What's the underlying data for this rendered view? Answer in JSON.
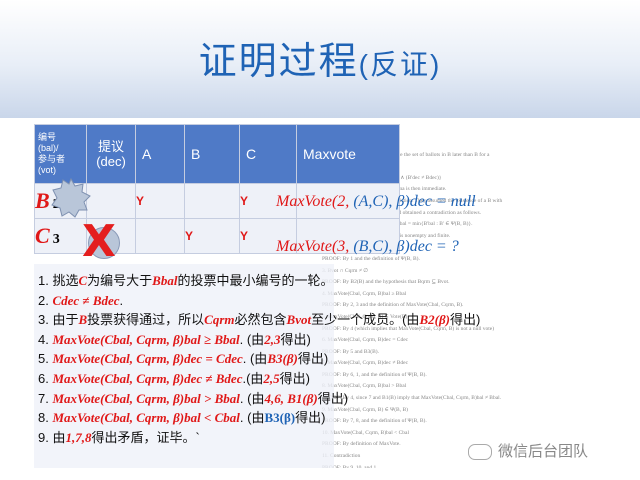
{
  "slide": {
    "title_main": "证明过程",
    "title_paren": "(反证)"
  },
  "table": {
    "headers": [
      "编号\n(bal)/\n参与者\n(vot)",
      "提议\n(dec)",
      "A",
      "B",
      "C",
      "Maxvote"
    ],
    "rows": [
      {
        "label": "B",
        "num": "2",
        "a": "Y",
        "b": "",
        "c": "Y",
        "maxvote": "MaxVote(2, (A,C), β)dec = null"
      },
      {
        "label": "C",
        "num": "3",
        "a": "",
        "b": "Y",
        "c": "Y",
        "maxvote": "MaxVote(3, (B,C), β)dec = ?"
      }
    ],
    "overlay_x": "X"
  },
  "steps": [
    {
      "num": "1.",
      "parts": [
        {
          "t": "挑选",
          "s": "n"
        },
        {
          "t": "C",
          "s": "ri"
        },
        {
          "t": "为编号大于",
          "s": "n"
        },
        {
          "t": "Bbal",
          "s": "ri"
        },
        {
          "t": "的投票中最小编号的一轮。",
          "s": "n"
        }
      ]
    },
    {
      "num": "2.",
      "parts": [
        {
          "t": "Cdec ≠ Bdec",
          "s": "ri"
        },
        {
          "t": ".",
          "s": "n"
        }
      ]
    },
    {
      "num": "3.",
      "parts": [
        {
          "t": "由于",
          "s": "n"
        },
        {
          "t": "B",
          "s": "ri"
        },
        {
          "t": "投票获得通过，所以",
          "s": "n"
        },
        {
          "t": "Cqrm",
          "s": "ri"
        },
        {
          "t": "必然包含",
          "s": "n"
        },
        {
          "t": "Bvot",
          "s": "ri"
        },
        {
          "t": "至少一个成员。(由",
          "s": "n"
        },
        {
          "t": "B2(β)",
          "s": "ri"
        },
        {
          "t": "得出)",
          "s": "n"
        }
      ]
    },
    {
      "num": "4.",
      "parts": [
        {
          "t": "MaxVote(Cbal, Cqrm, β)bal ≥ Bbal",
          "s": "ri"
        },
        {
          "t": ". (由",
          "s": "n"
        },
        {
          "t": "2,3",
          "s": "ri"
        },
        {
          "t": "得出)",
          "s": "n"
        }
      ]
    },
    {
      "num": "5.",
      "parts": [
        {
          "t": "MaxVote(Cbal, Cqrm, β)dec = Cdec",
          "s": "ri"
        },
        {
          "t": ". (由",
          "s": "n"
        },
        {
          "t": "B3(β)",
          "s": "ri"
        },
        {
          "t": "得出)",
          "s": "n"
        }
      ]
    },
    {
      "num": "6.",
      "parts": [
        {
          "t": "MaxVote(Cbal, Cqrm, β)dec ≠ Bdec",
          "s": "ri"
        },
        {
          "t": ".(由",
          "s": "n"
        },
        {
          "t": "2,5",
          "s": "ri"
        },
        {
          "t": "得出)",
          "s": "n"
        }
      ]
    },
    {
      "num": "7.",
      "parts": [
        {
          "t": "MaxVote(Cbal, Cqrm, β)bal > Bbal",
          "s": "ri"
        },
        {
          "t": ". (由",
          "s": "n"
        },
        {
          "t": "4,6, B1(β)",
          "s": "ri"
        },
        {
          "t": "得出)",
          "s": "n"
        }
      ]
    },
    {
      "num": "8.",
      "parts": [
        {
          "t": "MaxVote(Cbal, Cqrm, β)bal < Cbal",
          "s": "ri"
        },
        {
          "t": ". (由",
          "s": "n"
        },
        {
          "t": "B3(β)",
          "s": "bi"
        },
        {
          "t": "得出)",
          "s": "n"
        }
      ]
    },
    {
      "num": "9.",
      "parts": [
        {
          "t": "由",
          "s": "n"
        },
        {
          "t": "1,7,8",
          "s": "ri"
        },
        {
          "t": "得出矛盾，证毕。`",
          "s": "n"
        }
      ]
    }
  ],
  "proof_text": [
    "Proof of Lemma",
    "For any ballot B in B, let Ψ(B, B) be the set of ballots in B later than B for a",
    "decree different from B's:",
    "Ψ(B, B) = {B' ∈ B : (B'bal > Bbal) ∧ (B'dec ≠ Bdec)}",
    "Then if Ψ(B, B) is empty. The lemma is then immediate.",
    "The Proof? part is proof by contradiction. They assumed the existence of a B with",
    "Bqrm ⊆ Hvot and Ψ(B, B) ≠ ∅ and obtained a contradiction as follows.",
    "1. Choose C ∈ Ψ(B, B) such that Cbal = min{B'bal : B' ∈ Ψ(B, B)}.",
    "PROOF: C exists because Ψ(B, B) is nonempty and finite.",
    "2. Cbal > Bbal",
    "PROOF: By 1 and the definition of Ψ(B, B).",
    "3. Bvot ∩ Cqrm ≠ ∅",
    "PROOF: By B2(B) and the hypothesis that Bqrm ⊆ Bvot.",
    "4. MaxVote(Cbal, Cqrm, B)bal ≥ Bbal",
    "PROOF: By 2, 3 and the definition of MaxVote(Cbal, Cqrm, B).",
    "5. MaxVote(Cbal, Cqrm, B) ∈ Vote(B)",
    "PROOF: By 4 (which implies that MaxVote(Cbal, Cqrm, B) is not a null vote)",
    "6. MaxVote(Cbal, Cqrm, B)dec = Cdec",
    "PROOF: By 5 and B3(B).",
    "7. MaxVote(Cbal, Cqrm, B)dec ≠ Bdec",
    "PROOF: By 6, 1, and the definition of Ψ(B, B).",
    "8. MaxVote(Cbal, Cqrm, B)bal > Bbal",
    "PROOF: By 4, since 7 and B1(B) imply that MaxVote(Cbal, Cqrm, B)bal ≠ Bbal.",
    "9. MaxVote(Cbal, Cqrm, B) ∈ Ψ(B, B)",
    "PROOF: By 7, 8, and the definition of Ψ(B, B).",
    "10. MaxVote(Cbal, Cqrm, B)bal < Cbal",
    "PROOF: By definition of MaxVote.",
    "11. Contradiction",
    "PROOF: By 9, 10, and 1.",
    "End Proof of Lemma"
  ],
  "watermark": "微信后台团队"
}
